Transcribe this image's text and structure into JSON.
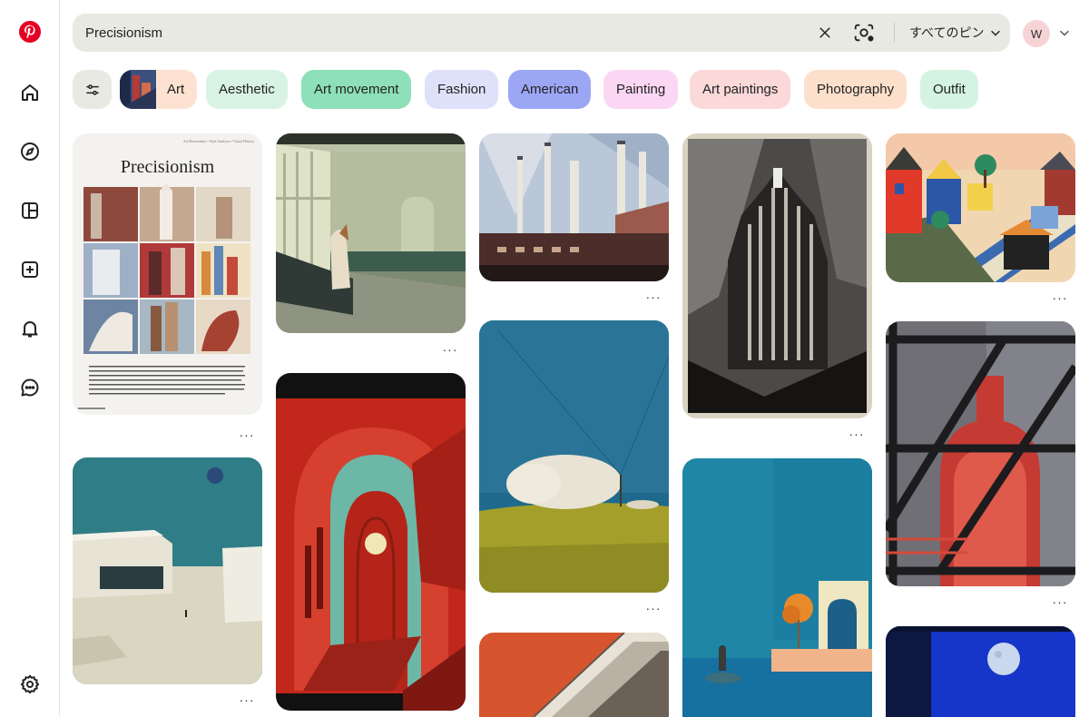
{
  "sidebar": {
    "items": [
      {
        "name": "home"
      },
      {
        "name": "explore"
      },
      {
        "name": "boards"
      },
      {
        "name": "create"
      },
      {
        "name": "notifications"
      },
      {
        "name": "messages"
      },
      {
        "name": "settings"
      }
    ]
  },
  "search": {
    "value": "Precisionism",
    "pin_filter_label": "すべてのピン"
  },
  "user": {
    "initial": "W"
  },
  "chips": [
    {
      "label": "Art",
      "color": "#fde2d1"
    },
    {
      "label": "Aesthetic",
      "color": "#d8f2e4"
    },
    {
      "label": "Art movement",
      "color": "#8ee0b8"
    },
    {
      "label": "Fashion",
      "color": "#dfe1fb"
    },
    {
      "label": "American",
      "color": "#9ba6f5"
    },
    {
      "label": "Painting",
      "color": "#fbd7f3"
    },
    {
      "label": "Art paintings",
      "color": "#fbd9d9"
    },
    {
      "label": "Photography",
      "color": "#fde0cc"
    },
    {
      "label": "Outfit",
      "color": "#d5f3e1"
    }
  ],
  "poster": {
    "title": "Precisionism",
    "subtitle": "Art Movements • Style Analysis • Visual History"
  },
  "more_label": "···"
}
